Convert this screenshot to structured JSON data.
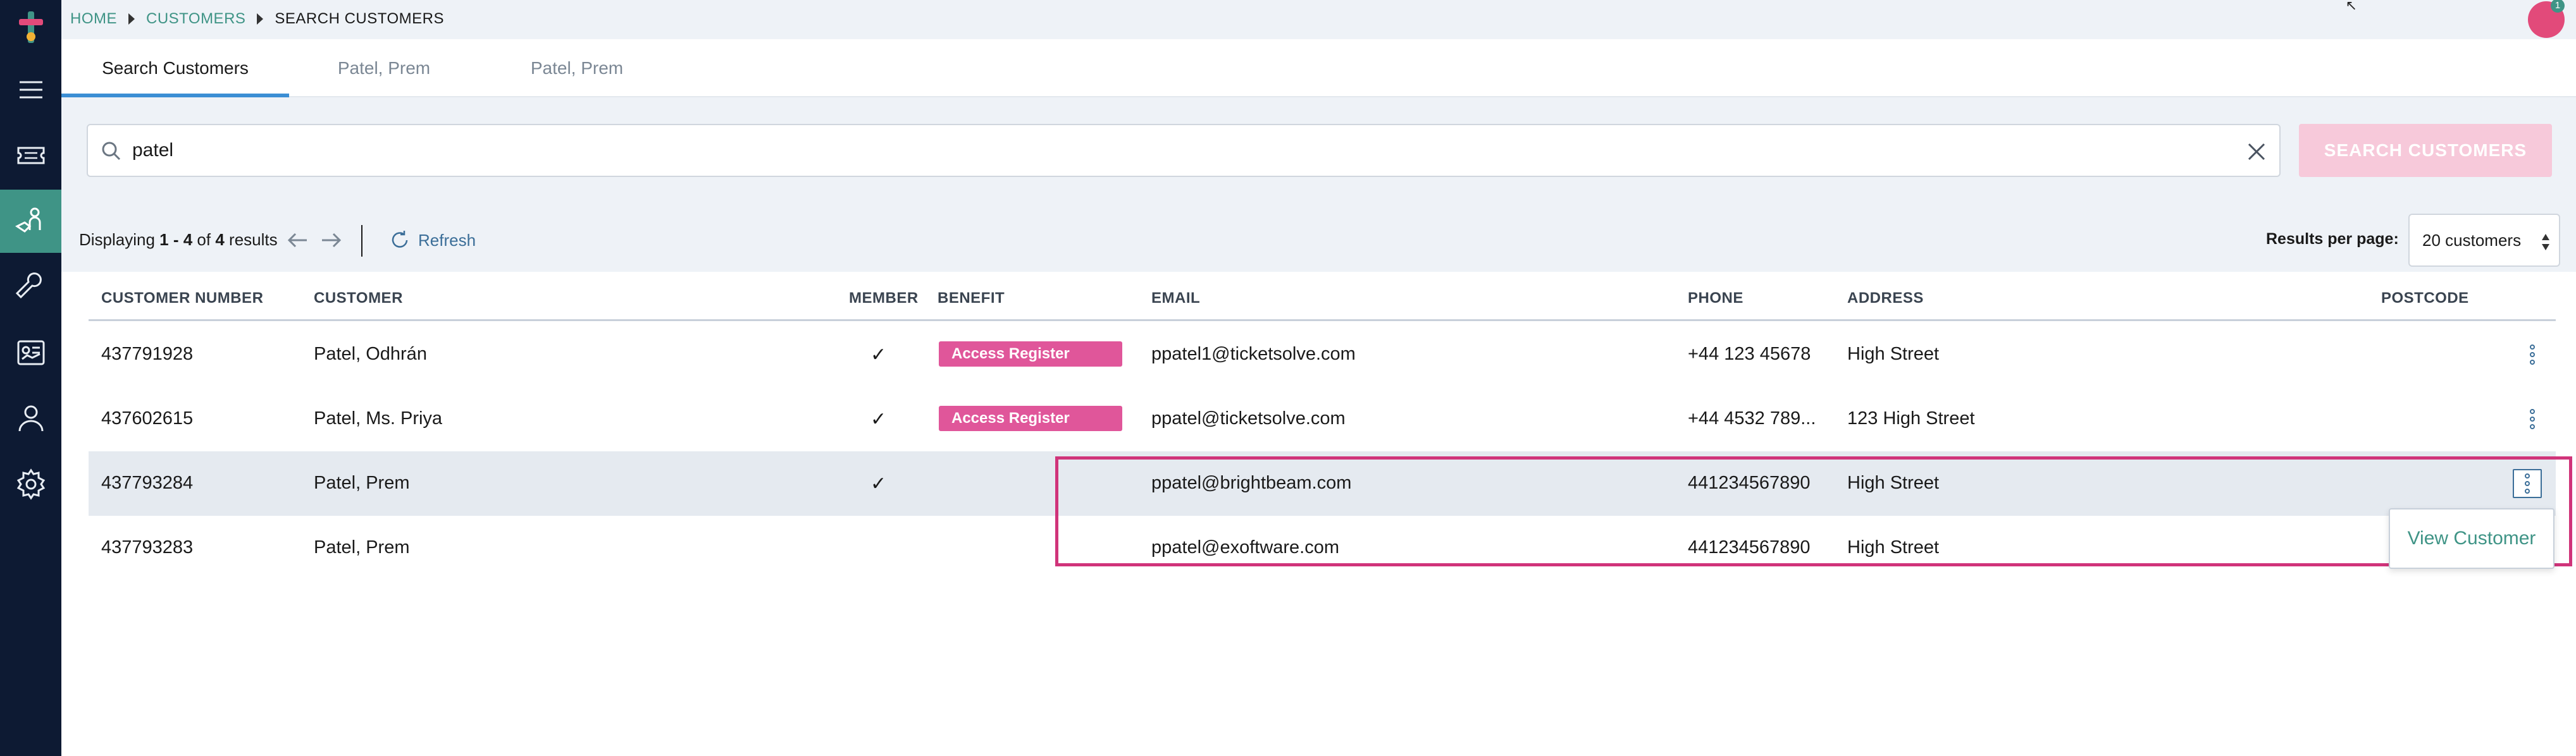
{
  "breadcrumb": {
    "home": "HOME",
    "customers": "CUSTOMERS",
    "current": "SEARCH CUSTOMERS"
  },
  "notifications": {
    "count": "1"
  },
  "tabs": [
    {
      "label": "Search Customers",
      "active": true
    },
    {
      "label": "Patel, Prem",
      "active": false
    },
    {
      "label": "Patel, Prem",
      "active": false
    }
  ],
  "search": {
    "value": "patel",
    "button_label": "SEARCH CUSTOMERS"
  },
  "results": {
    "prefix": "Displaying ",
    "start": "1 - 4",
    "of_text": " of ",
    "total": "4",
    "suffix": " results",
    "refresh_label": "Refresh",
    "per_page_label": "Results per page:",
    "per_page_value": "20 customers"
  },
  "table": {
    "headers": {
      "customer_number": "CUSTOMER NUMBER",
      "customer": "CUSTOMER",
      "member": "MEMBER",
      "benefit": "BENEFIT",
      "email": "EMAIL",
      "phone": "PHONE",
      "address": "ADDRESS",
      "postcode": "POSTCODE"
    },
    "rows": [
      {
        "number": "437791928",
        "customer": "Patel, Odhrán",
        "member": "✓",
        "benefit": "Access Register",
        "email": "ppatel1@ticketsolve.com",
        "phone": "+44 123 45678",
        "address": "High Street",
        "postcode": ""
      },
      {
        "number": "437602615",
        "customer": "Patel, Ms. Priya",
        "member": "✓",
        "benefit": "Access Register",
        "email": "ppatel@ticketsolve.com",
        "phone": "+44 4532 789...",
        "address": "123 High Street",
        "postcode": ""
      },
      {
        "number": "437793284",
        "customer": "Patel, Prem",
        "member": "✓",
        "benefit": "",
        "email": "ppatel@brightbeam.com",
        "phone": "441234567890",
        "address": "High Street",
        "postcode": ""
      },
      {
        "number": "437793283",
        "customer": "Patel, Prem",
        "member": "",
        "benefit": "",
        "email": "ppatel@exoftware.com",
        "phone": "441234567890",
        "address": "High Street",
        "postcode": ""
      }
    ]
  },
  "row_menu": {
    "view_customer": "View Customer"
  },
  "colors": {
    "sidebar": "#0d1a33",
    "accent": "#3f9486",
    "tab_underline": "#3b8ed4",
    "badge": "#e0569a",
    "highlight_border": "#d0347a",
    "search_btn": "#f7c9da"
  }
}
